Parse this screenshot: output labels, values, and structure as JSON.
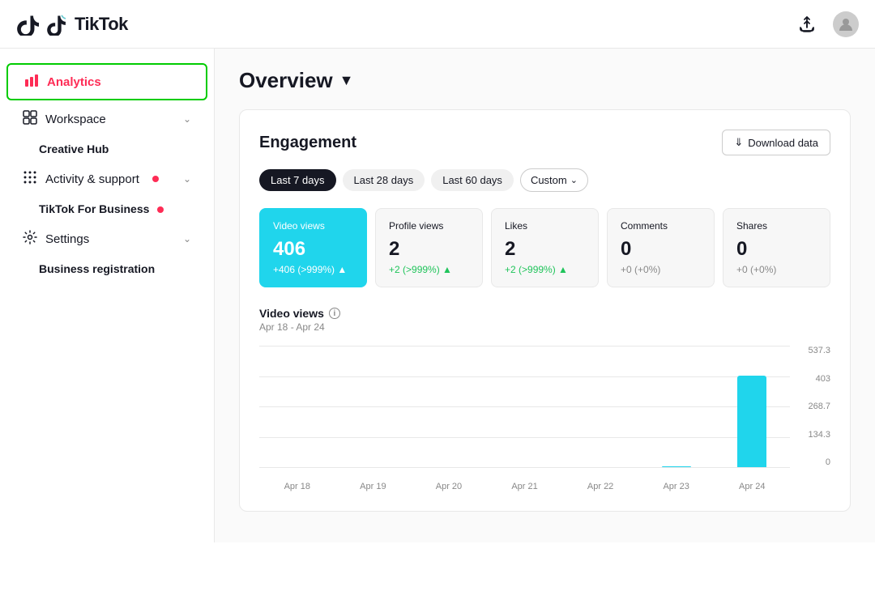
{
  "app": {
    "name": "TikTok"
  },
  "header": {
    "upload_icon_label": "upload",
    "account_icon_label": "account"
  },
  "sidebar": {
    "items": [
      {
        "id": "analytics",
        "label": "Analytics",
        "icon": "bar-chart",
        "active": true,
        "has_chevron": false
      },
      {
        "id": "workspace",
        "label": "Workspace",
        "icon": "grid",
        "active": false,
        "has_chevron": true
      },
      {
        "id": "creative-hub",
        "label": "Creative Hub",
        "icon": null,
        "active": false,
        "has_chevron": false,
        "is_sub": true
      },
      {
        "id": "activity-support",
        "label": "Activity & support",
        "icon": "grid-dots",
        "active": false,
        "has_chevron": true,
        "has_dot": true
      },
      {
        "id": "tiktok-for-business",
        "label": "TikTok For Business",
        "icon": null,
        "active": false,
        "has_chevron": false,
        "is_sub": true,
        "has_dot": true
      },
      {
        "id": "settings",
        "label": "Settings",
        "icon": "gear",
        "active": false,
        "has_chevron": true
      },
      {
        "id": "business-registration",
        "label": "Business registration",
        "icon": null,
        "active": false,
        "has_chevron": false,
        "is_sub": true
      }
    ]
  },
  "main": {
    "page_title": "Overview",
    "card": {
      "title": "Engagement",
      "download_btn": "Download data",
      "date_tabs": [
        {
          "label": "Last 7 days",
          "active": true
        },
        {
          "label": "Last 28 days",
          "active": false
        },
        {
          "label": "Last 60 days",
          "active": false
        }
      ],
      "custom_label": "Custom",
      "metrics": [
        {
          "label": "Video views",
          "value": "406",
          "change": "+406 (>999%)",
          "highlighted": true,
          "direction": "up"
        },
        {
          "label": "Profile views",
          "value": "2",
          "change": "+2 (>999%)",
          "highlighted": false,
          "direction": "up"
        },
        {
          "label": "Likes",
          "value": "2",
          "change": "+2 (>999%)",
          "highlighted": false,
          "direction": "up"
        },
        {
          "label": "Comments",
          "value": "0",
          "change": "+0 (+0%)",
          "highlighted": false,
          "direction": "neutral"
        },
        {
          "label": "Shares",
          "value": "0",
          "change": "+0 (+0%)",
          "highlighted": false,
          "direction": "neutral"
        }
      ],
      "chart": {
        "title": "Video views",
        "subtitle": "Apr 18 - Apr 24",
        "y_labels": [
          "537.3",
          "403",
          "268.7",
          "134.3",
          "0"
        ],
        "x_labels": [
          "Apr 18",
          "Apr 19",
          "Apr 20",
          "Apr 21",
          "Apr 22",
          "Apr 23",
          "Apr 24"
        ],
        "bars": [
          0,
          0,
          0,
          0,
          0,
          2,
          406
        ],
        "max": 537.3,
        "bar_color": "#20d5ec"
      }
    }
  }
}
